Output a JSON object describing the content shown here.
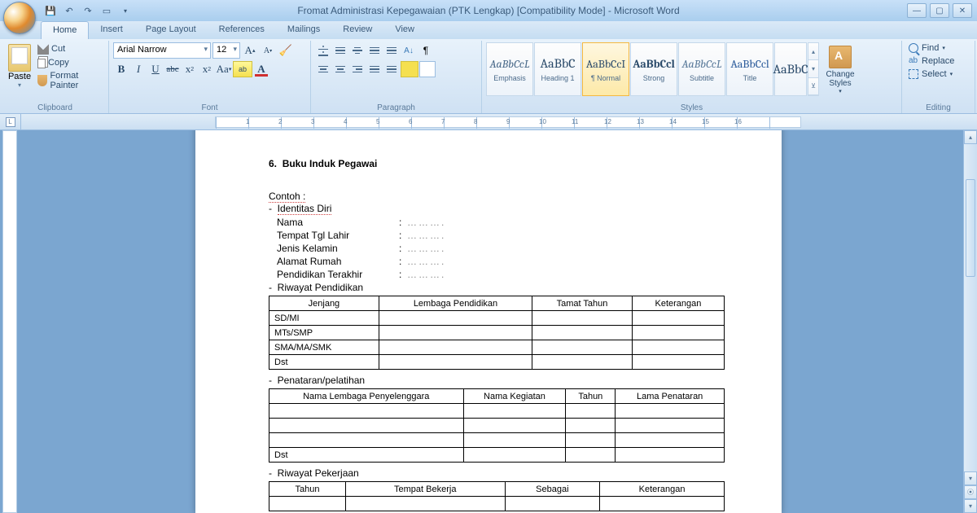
{
  "title": "Fromat Administrasi Kepegawaian (PTK Lengkap) [Compatibility Mode] - Microsoft Word",
  "tabs": [
    "Home",
    "Insert",
    "Page Layout",
    "References",
    "Mailings",
    "Review",
    "View"
  ],
  "active_tab": 0,
  "clipboard": {
    "paste": "Paste",
    "cut": "Cut",
    "copy": "Copy",
    "fmt": "Format Painter",
    "label": "Clipboard"
  },
  "font": {
    "name": "Arial Narrow",
    "size": "12",
    "label": "Font"
  },
  "paragraph": {
    "label": "Paragraph"
  },
  "styles": {
    "label": "Styles",
    "items": [
      {
        "preview": "AaBbCcL",
        "name": "Emphasis"
      },
      {
        "preview": "AaBbC",
        "name": "Heading 1"
      },
      {
        "preview": "AaBbCcI",
        "name": "¶ Normal"
      },
      {
        "preview": "AaBbCcl",
        "name": "Strong"
      },
      {
        "preview": "AaBbCcL",
        "name": "Subtitle"
      },
      {
        "preview": "AaBbCcl",
        "name": "Title"
      },
      {
        "preview": "AaBbC",
        "name": ""
      }
    ],
    "change": "Change Styles"
  },
  "editing": {
    "find": "Find",
    "replace": "Replace",
    "select": "Select",
    "label": "Editing"
  },
  "doc": {
    "heading_num": "6.",
    "heading": "Buku Induk Pegawai",
    "contoh": "Contoh :",
    "sec1": "Identitas Diri",
    "f1": "Nama",
    "f2": "Tempat Tgl Lahir",
    "f3": "Jenis Kelamin",
    "f4": "Alamat Rumah",
    "f5": "Pendidikan Terakhir",
    "dots": "……….",
    "sec2": "Riwayat Pendidikan",
    "t1": {
      "h": [
        "Jenjang",
        "Lembaga Pendidikan",
        "Tamat Tahun",
        "Keterangan"
      ],
      "r": [
        "SD/MI",
        "MTs/SMP",
        "SMA/MA/SMK",
        "Dst"
      ]
    },
    "sec3": "Penataran/pelatihan",
    "t2": {
      "h": [
        "Nama Lembaga Penyelenggara",
        "Nama Kegiatan",
        "Tahun",
        "Lama Penataran"
      ],
      "r4": "Dst"
    },
    "sec4": "Riwayat Pekerjaan",
    "t3": {
      "h": [
        "Tahun",
        "Tempat Bekerja",
        "Sebagai",
        "Keterangan"
      ]
    }
  }
}
